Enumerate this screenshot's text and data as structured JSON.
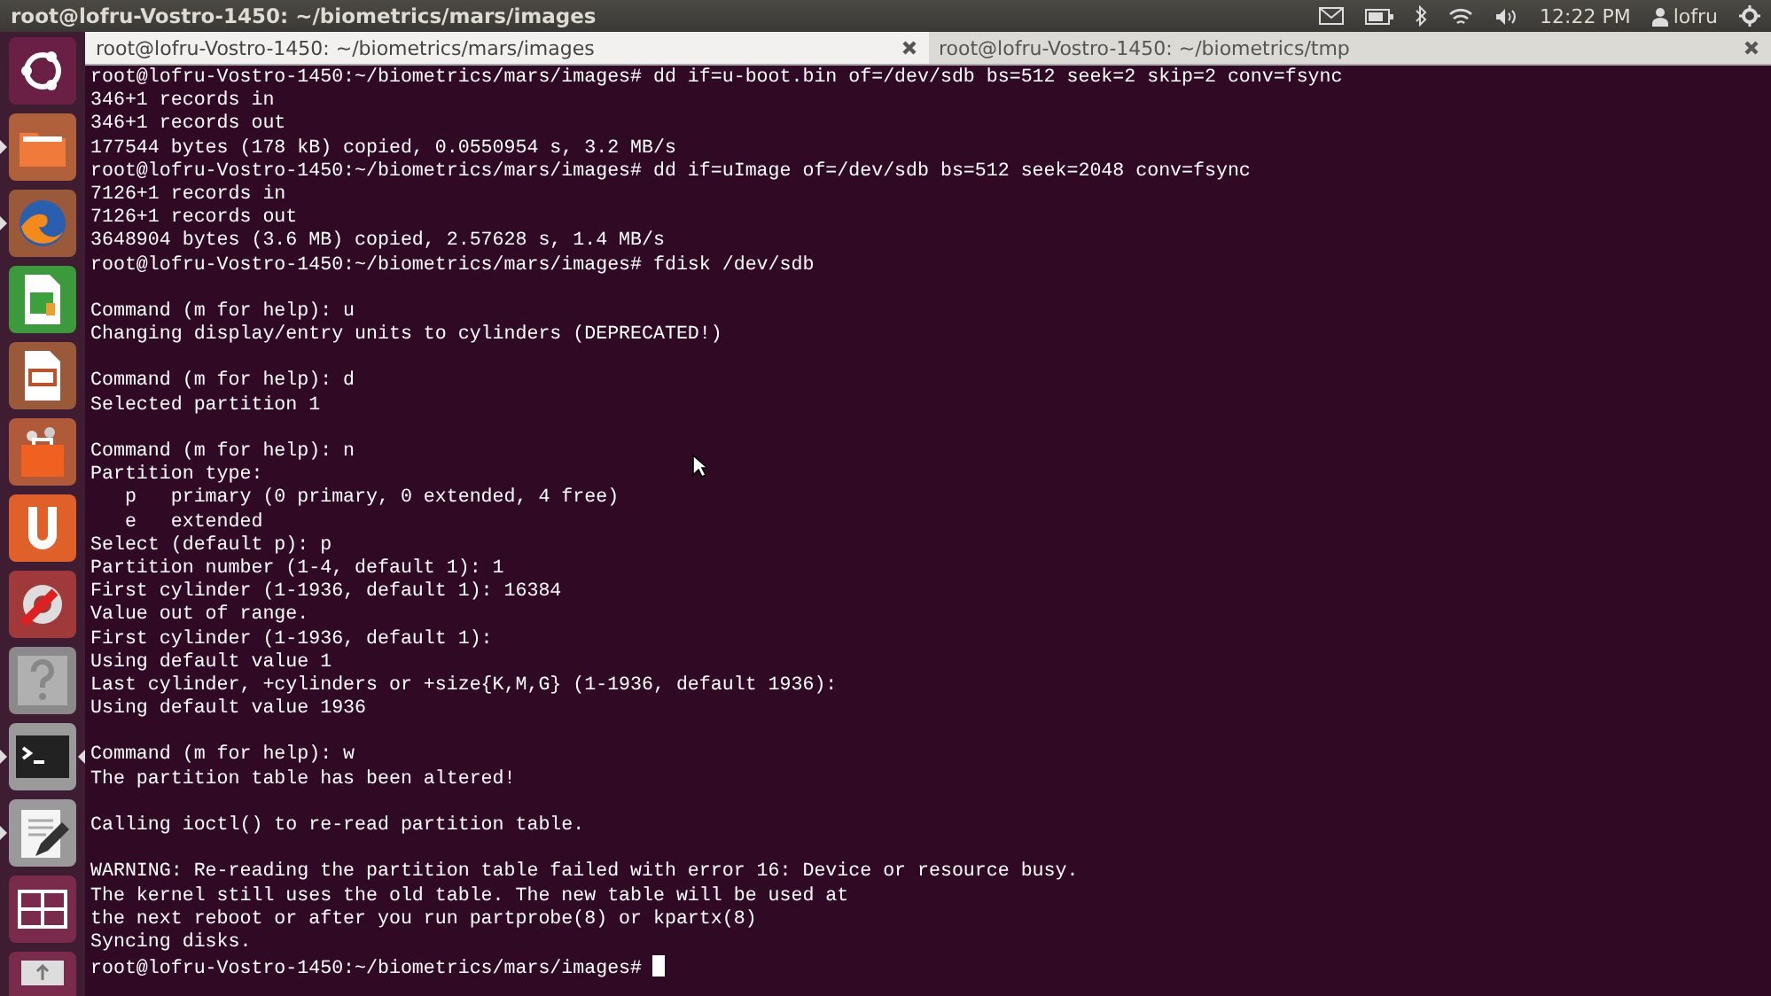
{
  "top_panel": {
    "title": "root@lofru-Vostro-1450: ~/biometrics/mars/images",
    "time": "12:22 PM",
    "user": "lofru"
  },
  "launcher": [
    {
      "kind": "dash",
      "running": false,
      "focused": false
    },
    {
      "kind": "files",
      "running": true,
      "focused": false
    },
    {
      "kind": "browser",
      "running": true,
      "focused": false
    },
    {
      "kind": "spreadsheet",
      "running": false,
      "focused": false
    },
    {
      "kind": "presentation",
      "running": false,
      "focused": false
    },
    {
      "kind": "store",
      "running": false,
      "focused": false
    },
    {
      "kind": "cloud",
      "running": false,
      "focused": false
    },
    {
      "kind": "settings",
      "running": false,
      "focused": false
    },
    {
      "kind": "help",
      "running": false,
      "focused": false
    },
    {
      "kind": "terminal",
      "running": true,
      "focused": true
    },
    {
      "kind": "editor",
      "running": true,
      "focused": false
    },
    {
      "kind": "workspaces",
      "running": false,
      "focused": false
    },
    {
      "kind": "drive",
      "running": false,
      "focused": false
    }
  ],
  "tabs": [
    {
      "label": "root@lofru-Vostro-1450: ~/biometrics/mars/images",
      "selected": true
    },
    {
      "label": "root@lofru-Vostro-1450: ~/biometrics/tmp",
      "selected": false
    }
  ],
  "terminal": {
    "blocks": [
      [
        "root@lofru-Vostro-1450:~/biometrics/mars/images# dd if=u-boot.bin of=/dev/sdb bs=512 seek=2 skip=2 conv=fsync",
        "346+1 records in",
        "346+1 records out",
        "177544 bytes (178 kB) copied, 0.0550954 s, 3.2 MB/s",
        "root@lofru-Vostro-1450:~/biometrics/mars/images# dd if=uImage of=/dev/sdb bs=512 seek=2048 conv=fsync",
        "7126+1 records in",
        "7126+1 records out",
        "3648904 bytes (3.6 MB) copied, 2.57628 s, 1.4 MB/s",
        "root@lofru-Vostro-1450:~/biometrics/mars/images# fdisk /dev/sdb"
      ],
      [
        "Command (m for help): u",
        "Changing display/entry units to cylinders (DEPRECATED!)"
      ],
      [
        "Command (m for help): d",
        "Selected partition 1"
      ],
      [
        "Command (m for help): n",
        "Partition type:",
        "   p   primary (0 primary, 0 extended, 4 free)",
        "   e   extended",
        "Select (default p): p",
        "Partition number (1-4, default 1): 1",
        "First cylinder (1-1936, default 1): 16384",
        "Value out of range.",
        "First cylinder (1-1936, default 1):",
        "Using default value 1",
        "Last cylinder, +cylinders or +size{K,M,G} (1-1936, default 1936):",
        "Using default value 1936"
      ],
      [
        "Command (m for help): w",
        "The partition table has been altered!"
      ],
      [
        "Calling ioctl() to re-read partition table."
      ],
      [
        "WARNING: Re-reading the partition table failed with error 16: Device or resource busy.",
        "The kernel still uses the old table. The new table will be used at",
        "the next reboot or after you run partprobe(8) or kpartx(8)",
        "Syncing disks."
      ]
    ],
    "prompt": "root@lofru-Vostro-1450:~/biometrics/mars/images#"
  }
}
